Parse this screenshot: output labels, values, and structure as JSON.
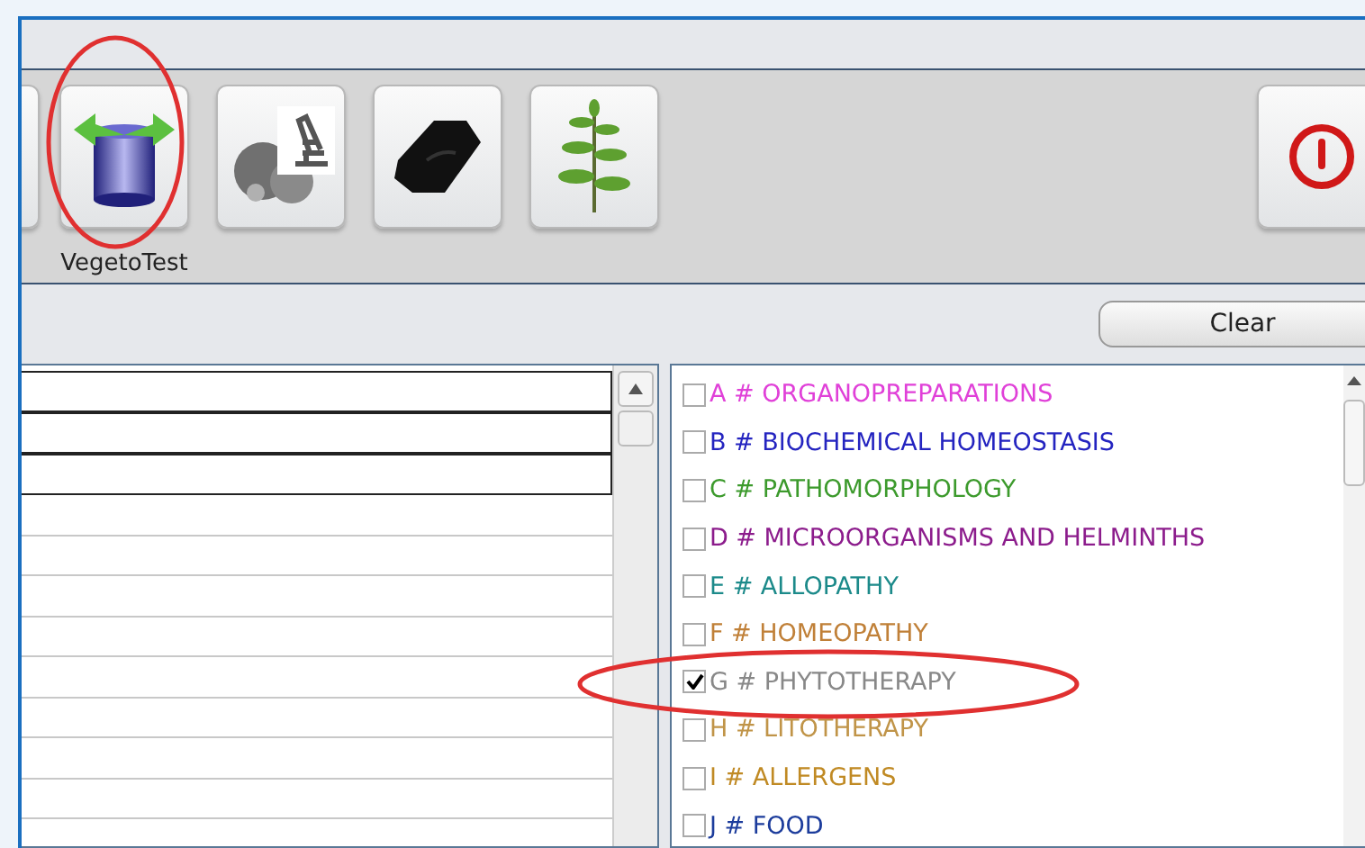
{
  "toolbar": {
    "buttons": [
      {
        "kind": "partial"
      },
      {
        "kind": "cylinder",
        "label": "VegetoTest"
      },
      {
        "kind": "microscope"
      },
      {
        "kind": "stone"
      },
      {
        "kind": "plant"
      },
      {
        "kind": "power"
      }
    ]
  },
  "clear_button": {
    "label": "Clear"
  },
  "table": {
    "rows": [
      {
        "framed": true
      },
      {
        "framed": true
      },
      {
        "framed": true
      },
      {
        "framed": false
      },
      {
        "framed": false
      },
      {
        "framed": false
      },
      {
        "framed": false
      },
      {
        "framed": false
      },
      {
        "framed": false
      },
      {
        "framed": false
      },
      {
        "framed": false
      }
    ]
  },
  "categories": [
    {
      "label": "A # ORGANOPREPARATIONS",
      "checked": false,
      "color": "#e040d8"
    },
    {
      "label": "B # BIOCHEMICAL HOMEOSTASIS",
      "checked": false,
      "color": "#2424c0"
    },
    {
      "label": "C # PATHOMORPHOLOGY",
      "checked": false,
      "color": "#3c9a2c"
    },
    {
      "label": "D # MICROORGANISMS AND HELMINTHS",
      "checked": false,
      "color": "#8c1c8c"
    },
    {
      "label": "E # ALLOPATHY",
      "checked": false,
      "color": "#1c8a8a"
    },
    {
      "label": "F # HOMEOPATHY",
      "checked": false,
      "color": "#c08038"
    },
    {
      "label": "G # PHYTOTHERAPY",
      "checked": true,
      "color": "#888888"
    },
    {
      "label": "H # LITOTHERAPY",
      "checked": false,
      "color": "#c09448"
    },
    {
      "label": "I # ALLERGENS",
      "checked": false,
      "color": "#c08a24"
    },
    {
      "label": "J # FOOD",
      "checked": false,
      "color": "#1c3c9c"
    }
  ],
  "annotations": [
    {
      "kind": "ellipse"
    },
    {
      "kind": "ellipse"
    }
  ]
}
